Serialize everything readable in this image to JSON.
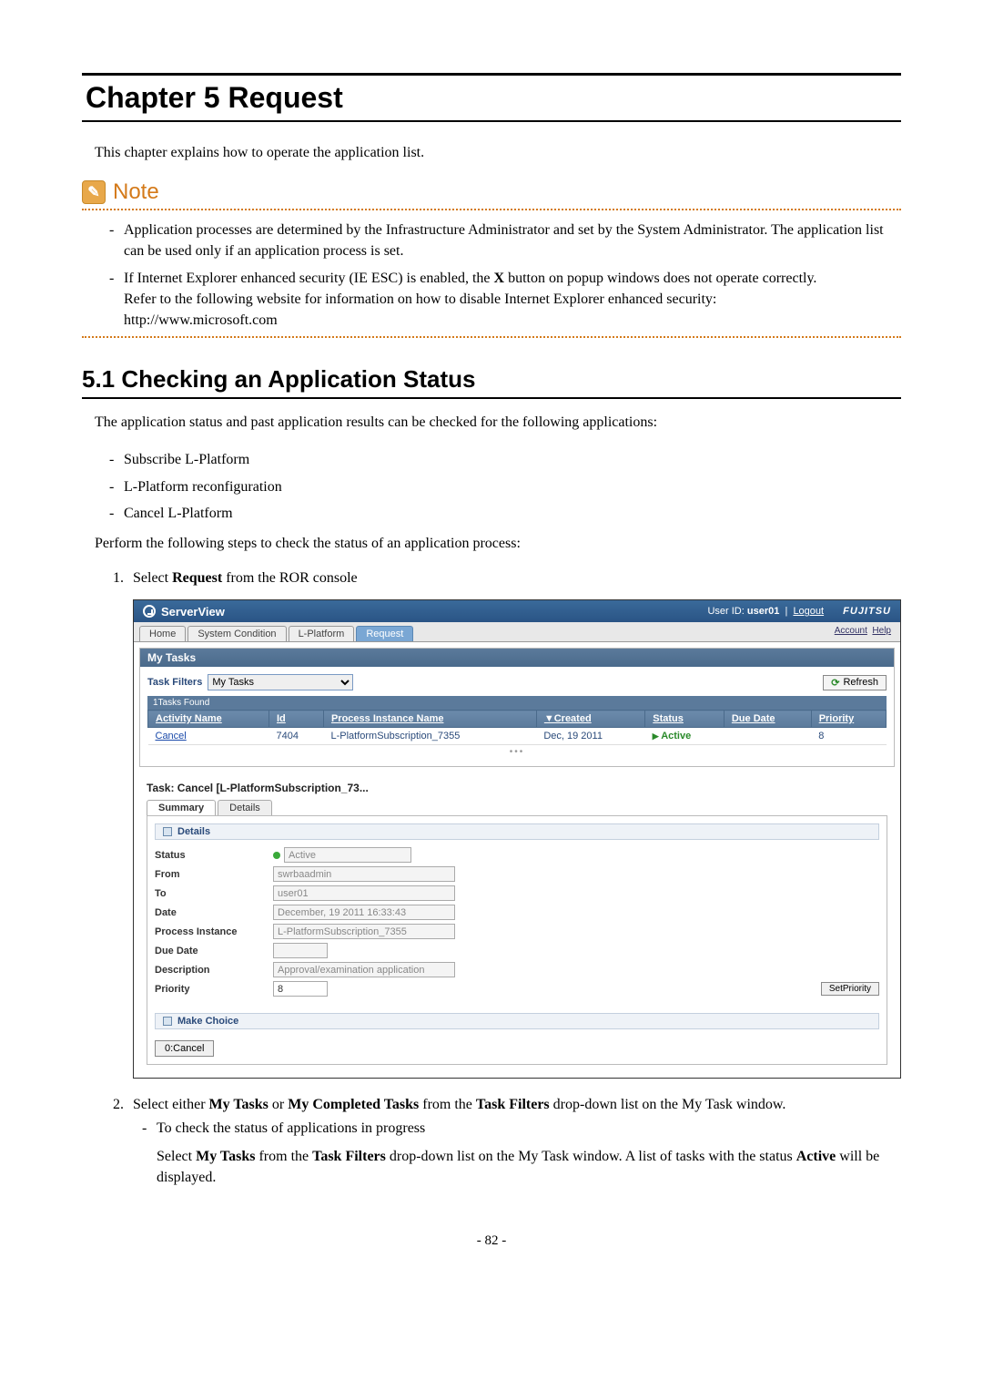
{
  "chapter_title": "Chapter 5 Request",
  "intro": "This chapter explains how to operate the application list.",
  "note_label": "Note",
  "note_items": [
    "Application processes are determined by the Infrastructure Administrator and set by the System Administrator. The application list can be used only if an application process is set.",
    "If Internet Explorer enhanced security (IE ESC) is enabled, the X button on popup windows does not operate correctly. Refer to the following website for information on how to disable Internet Explorer enhanced security: http://www.microsoft.com"
  ],
  "section_title": "5.1 Checking an Application Status",
  "section_intro": "The application status and past application results can be checked for the following applications:",
  "check_list": [
    "Subscribe L-Platform",
    "L-Platform reconfiguration",
    "Cancel L-Platform"
  ],
  "perform_text": "Perform the following steps to check the status of an application process:",
  "step1_prefix": "Select ",
  "step1_bold": "Request",
  "step1_suffix": " from the ROR console",
  "app": {
    "product": "ServerView",
    "user_label": "User ID:",
    "user_id": "user01",
    "logout": "Logout",
    "brand": "FUJITSU",
    "tabs": [
      "Home",
      "System Condition",
      "L-Platform",
      "Request"
    ],
    "account": "Account",
    "help": "Help",
    "my_tasks_title": "My Tasks",
    "task_filters_label": "Task Filters",
    "task_filter_value": "My Tasks",
    "refresh": "Refresh",
    "tasks_found": "1Tasks Found",
    "columns": {
      "activity": "Activity Name",
      "id": "Id",
      "process": "Process Instance Name",
      "created": "▼Created",
      "status": "Status",
      "due": "Due Date",
      "priority": "Priority"
    },
    "row": {
      "activity": "Cancel",
      "id": "7404",
      "process": "L-PlatformSubscription_7355",
      "created": "Dec, 19 2011",
      "status": "Active",
      "due": "",
      "priority": "8"
    },
    "task_title": "Task: Cancel [L-PlatformSubscription_73...",
    "dtabs": [
      "Summary",
      "Details"
    ],
    "details_header": "Details",
    "form": {
      "status_lbl": "Status",
      "status_val": "Active",
      "from_lbl": "From",
      "from_val": "swrbaadmin",
      "to_lbl": "To",
      "to_val": "user01",
      "date_lbl": "Date",
      "date_val": "December, 19 2011 16:33:43",
      "pi_lbl": "Process Instance",
      "pi_val": "L-PlatformSubscription_7355",
      "dd_lbl": "Due Date",
      "dd_val": "",
      "desc_lbl": "Description",
      "desc_val": "Approval/examination application",
      "prio_lbl": "Priority",
      "prio_val": "8",
      "setprio": "SetPriority"
    },
    "make_choice": "Make Choice",
    "choice_btn": "0:Cancel"
  },
  "step2_parts": {
    "p1": "Select either ",
    "b1": "My Tasks",
    "p2": " or ",
    "b2": "My Completed Tasks",
    "p3": " from the ",
    "b3": "Task Filters",
    "p4": " drop-down list on the My Task window."
  },
  "step2_sub_label": "To check the status of applications in progress",
  "step2_sub_text": {
    "p1": "Select ",
    "b1": "My Tasks",
    "p2": " from the ",
    "b2": "Task Filters",
    "p3": " drop-down list on the My Task window. A list of tasks with the status ",
    "b3": "Active",
    "p4": " will be displayed."
  },
  "page_number": "- 82 -"
}
